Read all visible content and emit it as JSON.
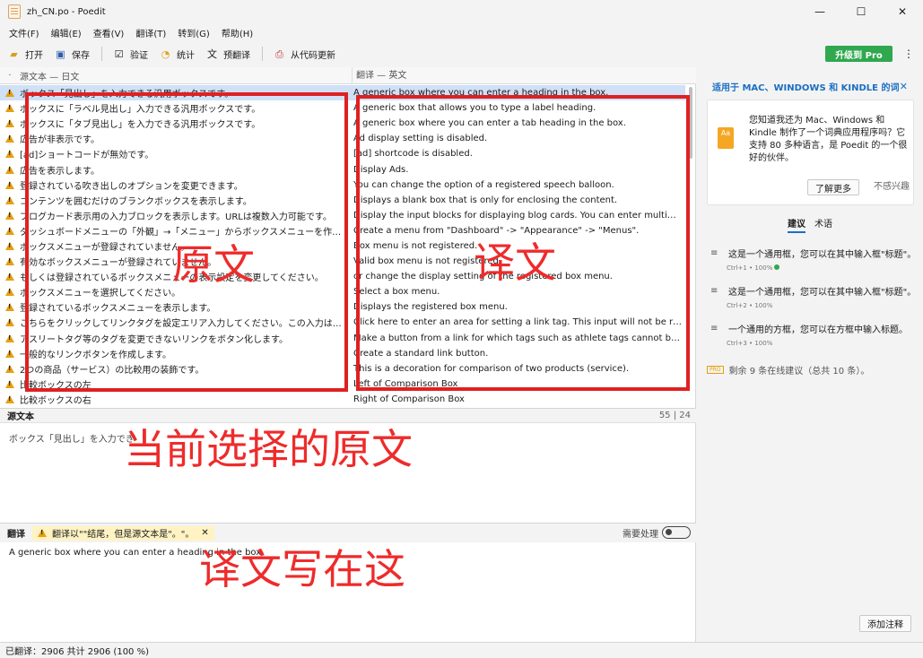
{
  "window": {
    "title": "zh_CN.po - Poedit",
    "minimize": "—",
    "maximize": "☐",
    "close": "✕"
  },
  "menu": [
    "文件(F)",
    "编辑(E)",
    "查看(V)",
    "翻译(T)",
    "转到(G)",
    "帮助(H)"
  ],
  "toolbar": {
    "open": "打开",
    "save": "保存",
    "validate": "验证",
    "stats": "统计",
    "pretranslate": "预翻译",
    "update": "从代码更新",
    "upgrade": "升级到 Pro",
    "more": "⋮"
  },
  "columns": {
    "source": "源文本 — 日文",
    "translation": "翻译 — 英文",
    "marker": "·"
  },
  "rows": [
    {
      "src": "ボックス「見出し」を入力できる汎用ボックスです。",
      "trn": "A generic box where you can enter a heading in the box."
    },
    {
      "src": "ボックスに「ラベル見出し」入力できる汎用ボックスです。",
      "trn": "A generic box that allows you to type a label heading."
    },
    {
      "src": "ボックスに「タブ見出し」を入力できる汎用ボックスです。",
      "trn": "A generic box where you can enter a tab heading in the box."
    },
    {
      "src": "広告が非表示です。",
      "trn": "Ad display setting is disabled."
    },
    {
      "src": "[ad]ショートコードが無効です。",
      "trn": "[ad] shortcode is disabled."
    },
    {
      "src": "広告を表示します。",
      "trn": "Display Ads."
    },
    {
      "src": "登録されている吹き出しのオプションを変更できます。",
      "trn": "You can change the option of a registered speech balloon."
    },
    {
      "src": "コンテンツを囲むだけのブランクボックスを表示します。",
      "trn": "Displays a blank box that is only for enclosing the content."
    },
    {
      "src": "ブログカード表示用の入力ブロックを表示します。URLは複数入力可能です。",
      "trn": "Display the input blocks for displaying blog cards. You can enter multiple URLs."
    },
    {
      "src": "ダッシュボードメニューの「外観」→「メニュー」からボックスメニューを作成してください。",
      "trn": "Create a menu from \"Dashboard\" -> \"Appearance\" -> \"Menus\"."
    },
    {
      "src": "ボックスメニューが登録されていません。",
      "trn": "Box menu is not registered."
    },
    {
      "src": "有効なボックスメニューが登録されていません。",
      "trn": "Valid box menu is not registered."
    },
    {
      "src": "もしくは登録されているボックスメニューの表示設定を変更してください。",
      "trn": "or change the display setting of the registered box menu."
    },
    {
      "src": "ボックスメニューを選択してください。",
      "trn": "Select a box menu."
    },
    {
      "src": "登録されているボックスメニューを表示します。",
      "trn": "Displays the registered box menu."
    },
    {
      "src": "こちらをクリックしてリンクタグを設定エリア入力してください。この入力は公開されます。",
      "trn": "Click here to enter an area for setting a link tag. This input will not be reflected."
    },
    {
      "src": "アスリートタグ等のタグを変更できないリンクをボタン化します。",
      "trn": "Make a button from a link for which tags such as athlete tags cannot be changed."
    },
    {
      "src": "一般的なリンクボタンを作成します。",
      "trn": "Create a standard link button."
    },
    {
      "src": "2つの商品（サービス）の比較用の装飾です。",
      "trn": "This is a decoration for comparison of two products (service)."
    },
    {
      "src": "比較ボックスの左",
      "trn": "Left of Comparison Box"
    },
    {
      "src": "比較ボックスの右",
      "trn": "Right of Comparison Box"
    }
  ],
  "source_pane": {
    "label": "源文本",
    "counter": "55 | 24",
    "text": "ボックス「見出し」を入力でき"
  },
  "translation_pane": {
    "label": "翻译",
    "warning": "翻译以\"\"结尾，但是源文本是\"。\"。",
    "warning_close": "✕",
    "needs_work": "需要处理",
    "text": "A generic box where you can enter a heading in the box."
  },
  "annotations": {
    "source_label": "原文",
    "translation_label": "译文",
    "current_source": "当前选择的原文",
    "write_here": "译文写在这"
  },
  "sidebar": {
    "promo_title": "适用于 MAC、WINDOWS 和 KINDLE 的词",
    "promo_close": "✕",
    "promo_text": "您知道我还为 Mac、Windows 和 Kindle 制作了一个词典应用程序吗？它支持 80 多种语言，是 Poedit 的一个很好的伙伴。",
    "promo_icon_text": "Aa",
    "learn_more": "了解更多",
    "not_interested": "不感兴趣",
    "tab_suggestions": "建议",
    "tab_terms": "术语",
    "suggestions": [
      {
        "text": "这是一个通用框，您可以在其中输入框\"标题\"。",
        "meta": "Ctrl+1 • 100%"
      },
      {
        "text": "这是一个通用框，您可以在其中输入框\"标题\"。",
        "meta": "Ctrl+2 • 100%"
      },
      {
        "text": "一个通用的方框，您可以在方框中输入标题。",
        "meta": "Ctrl+3 • 100%"
      }
    ],
    "pro_badge": "PRO",
    "pro_note": "剩余 9 条在线建议（总共 10 条）。",
    "add_comment": "添加注释"
  },
  "status": {
    "text": "已翻译：2906 共计 2906 (100 %)"
  },
  "colors": {
    "accent": "#1a6fc2",
    "upgrade": "#2fa84f",
    "warning": "#e5a00d",
    "annotation": "#e02020"
  }
}
